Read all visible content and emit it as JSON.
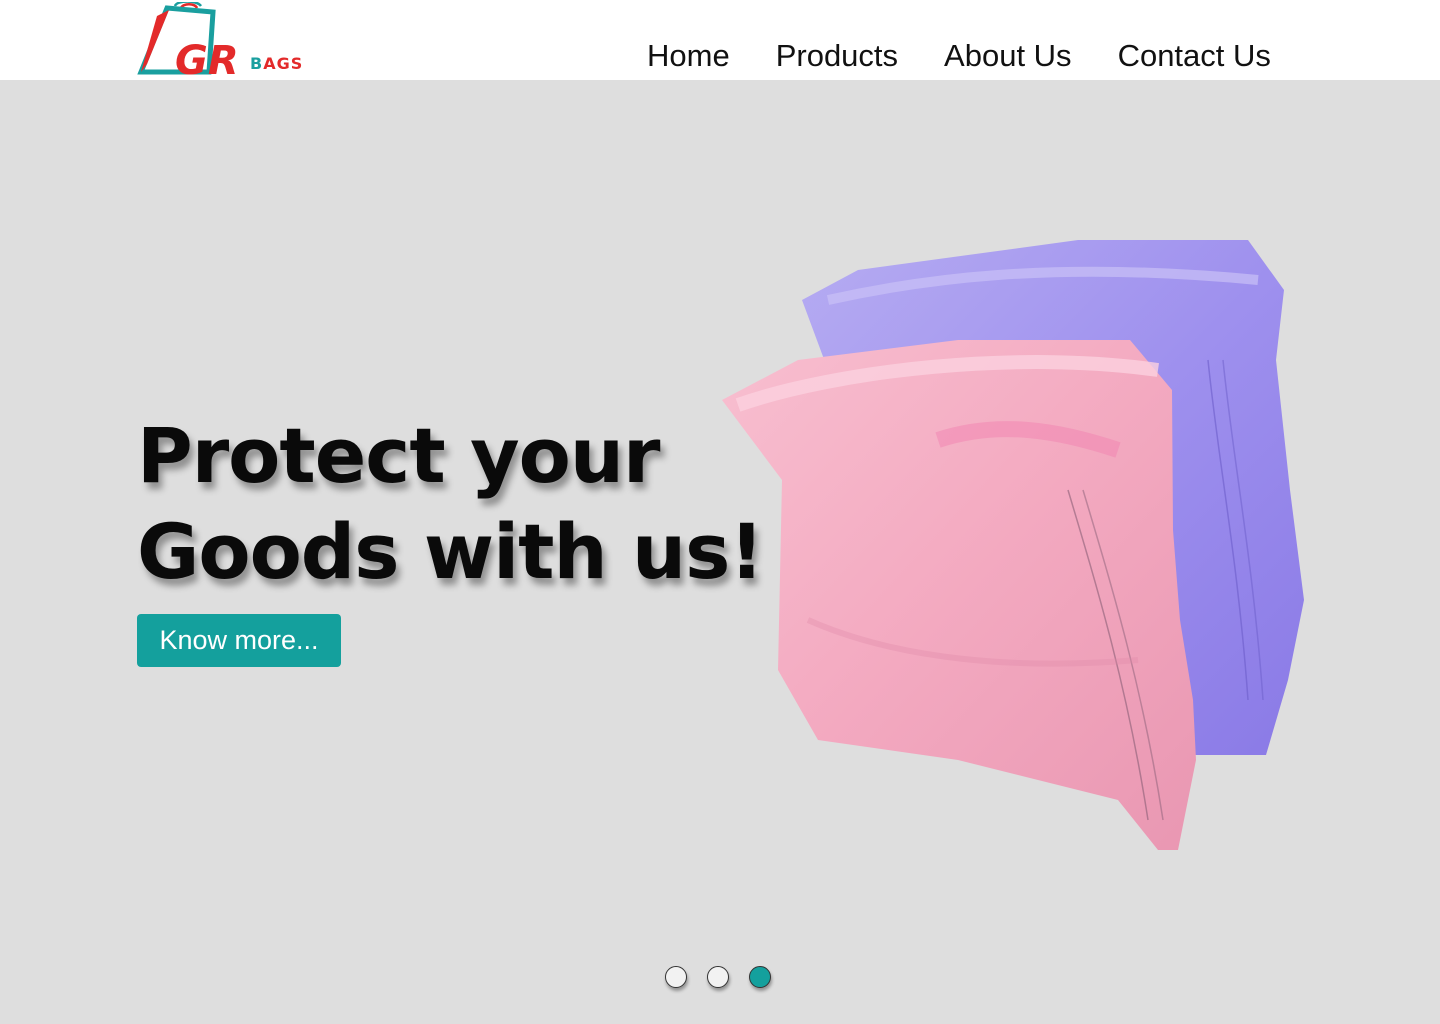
{
  "brand": {
    "logo_letters": "GR",
    "logo_suffix_first": "B",
    "logo_suffix_rest": "AGS",
    "teal": "#1a9f9f",
    "red": "#e32a2a"
  },
  "nav": {
    "items": [
      {
        "label": "Home"
      },
      {
        "label": "Products"
      },
      {
        "label": "About Us"
      },
      {
        "label": "Contact Us"
      }
    ]
  },
  "hero": {
    "headline_line1": "Protect your",
    "headline_line2": "Goods with us!",
    "cta_label": "Know more...",
    "background": "#dedede",
    "accent": "#14a09d"
  },
  "carousel": {
    "total_slides": 3,
    "active_slide": 3
  }
}
